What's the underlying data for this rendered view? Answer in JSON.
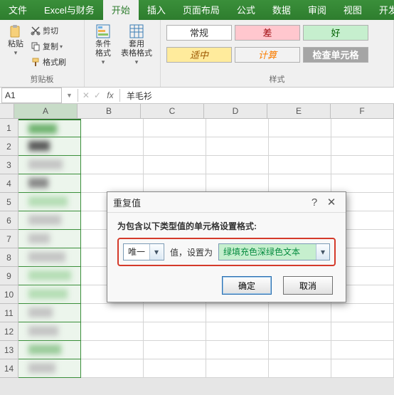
{
  "tabs": {
    "file": "文件",
    "custom": "Excel与财务",
    "home": "开始",
    "insert": "插入",
    "layout": "页面布局",
    "formula": "公式",
    "data": "数据",
    "review": "审阅",
    "view": "视图",
    "dev": "开发"
  },
  "ribbon": {
    "clipboard": {
      "label": "剪贴板",
      "paste": "粘贴",
      "cut": "剪切",
      "copy": "复制",
      "painter": "格式刷"
    },
    "cond": {
      "label": "条件格式",
      "table": "套用\n表格格式"
    },
    "styles": {
      "label": "样式",
      "normal": "常规",
      "bad": "差",
      "good": "好",
      "neutral": "适中",
      "calc": "计算",
      "check": "检查单元格"
    }
  },
  "namebox": "A1",
  "fx_value": "羊毛衫",
  "cols": [
    "A",
    "B",
    "C",
    "D",
    "E",
    "F"
  ],
  "rowcount": 14,
  "dialog": {
    "title": "重复值",
    "help_tip": "?",
    "header": "为包含以下类型值的单元格设置格式:",
    "type_value": "唯一",
    "mid_label": "值，设置为",
    "format_value": "绿填充色深绿色文本",
    "ok": "确定",
    "cancel": "取消"
  }
}
